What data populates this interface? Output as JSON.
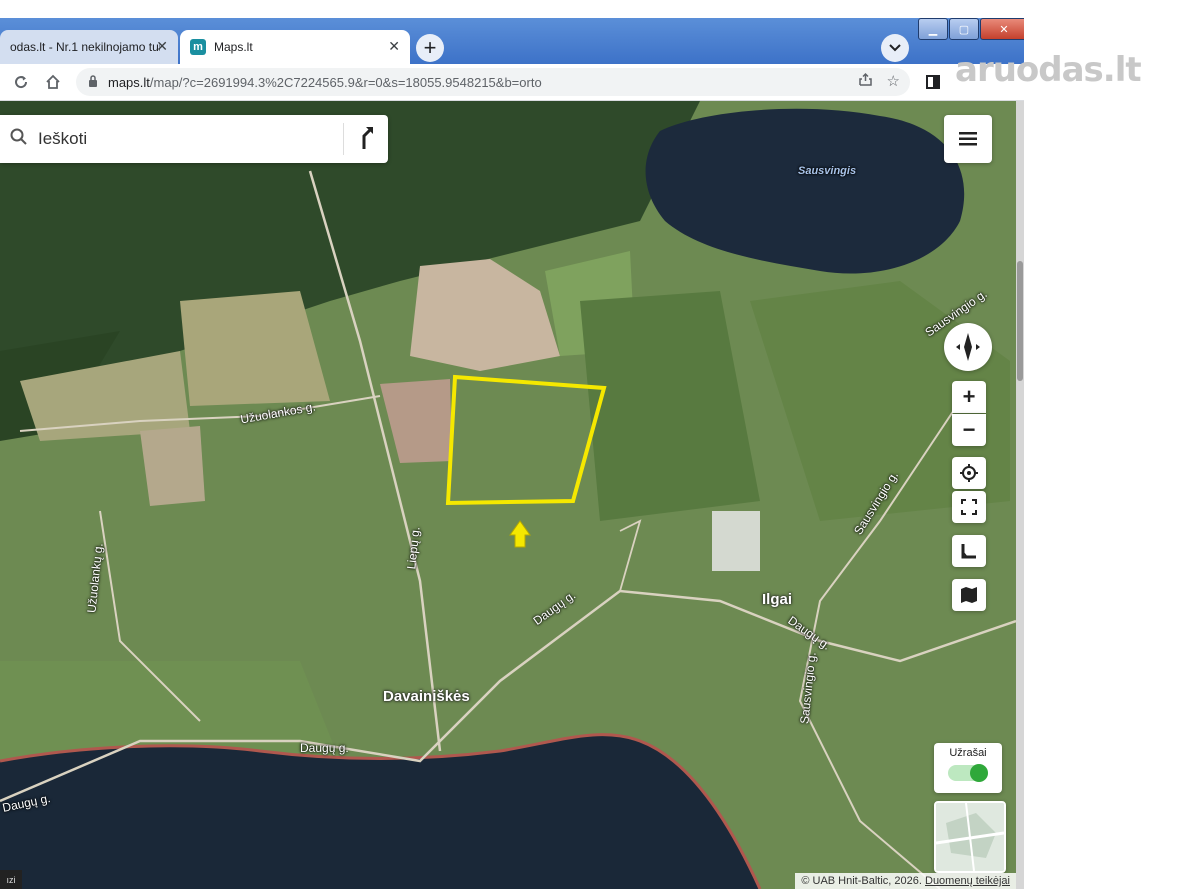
{
  "browser": {
    "tabs": [
      {
        "title": "odas.lt - Nr.1 nekilnojamo tur",
        "active": false
      },
      {
        "title": "Maps.lt",
        "active": true
      }
    ],
    "new_tab_symbol": "+",
    "url_host": "maps.lt",
    "url_path": "/map/?c=2691994.3%2C7224565.9&r=0&s=18055.9548215&b=orto"
  },
  "map": {
    "search_placeholder": "Ieškoti",
    "labels": {
      "lake_north": "Sausvingis",
      "road_uzuolankos": "Užuolankos g.",
      "road_uzuolanku": "Užuolankų g.",
      "road_liepu": "Liepų g.",
      "road_daugu_1": "Daugų g.",
      "road_daugu_2": "Daugų g.",
      "road_daugu_3": "Daugų g.",
      "road_daugu_4": "Daugų g.",
      "road_sausvingio_1": "Sausvingio g.",
      "road_sausvingio_2": "Sausvingio g.",
      "road_sausvingio_3": "Sausvingio g."
    },
    "places": {
      "davainiskes": "Davainiškės",
      "ilgai": "Ilgai"
    },
    "notes_label": "Užrašai",
    "notes_toggle_on": true,
    "attribution_prefix": "© UAB Hnit-Baltic, 2026. ",
    "attribution_link": "Duomenų teikėjai",
    "bottom_left_fragment": "ızi",
    "colors": {
      "plot_outline": "#f5e800",
      "arrow": "#f5e800",
      "toggle_on": "#2fa83a"
    }
  },
  "watermark": {
    "brand": "aruodas",
    "tld": ".lt"
  }
}
